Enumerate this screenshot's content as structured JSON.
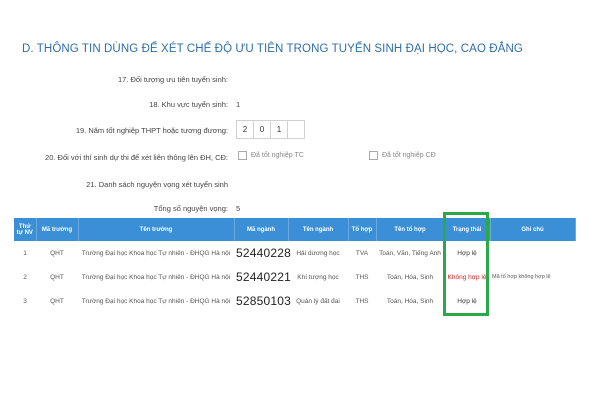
{
  "section": {
    "title": "D. THÔNG TIN DÙNG ĐỂ XÉT CHẾ ĐỘ ƯU TIÊN TRONG TUYỂN SINH ĐẠI HỌC, CAO ĐẲNG"
  },
  "fields": {
    "f17_label": "17. Đối tượng ưu tiên tuyển sinh:",
    "f18_label": "18. Khu vực tuyển sinh:",
    "f18_value": "1",
    "f19_label": "19. Năm tốt nghiệp THPT hoặc tương đương:",
    "f19_digits": [
      "2",
      "0",
      "1",
      ""
    ],
    "f20_label": "20. Đối với thí sinh dự thi để xét liên thông lên ĐH, CĐ:",
    "f20_opt1": "Đã tốt nghiệp TC",
    "f20_opt2": "Đã tốt nghiệp CĐ",
    "f21_label": "21. Danh sách nguyện vọng xét tuyển sinh",
    "total_label": "Tổng số nguyện vọng:",
    "total_value": "5"
  },
  "table": {
    "headers": {
      "nv": "Thứ tự NV",
      "ma_truong": "Mã trường",
      "ten_truong": "Tên trường",
      "ma_nganh": "Mã ngành",
      "ten_nganh": "Tên ngành",
      "to_hop": "Tổ hợp",
      "ten_to_hop": "Tên tổ hợp",
      "trang_thai": "Trạng thái",
      "ghi_chu": "Ghi chú"
    },
    "rows": [
      {
        "nv": "1",
        "ma_truong": "QHT",
        "ten_truong": "Trường Đại học Khoa học Tự nhiên - ĐHQG Hà nội",
        "ma_nganh": "52440228",
        "ten_nganh": "Hải dương học",
        "to_hop": "TVA",
        "ten_to_hop": "Toán, Văn, Tiếng Anh",
        "trang_thai": "Hợp lệ",
        "ghi_chu": ""
      },
      {
        "nv": "2",
        "ma_truong": "QHT",
        "ten_truong": "Trường Đại học Khoa học Tự nhiên - ĐHQG Hà nội",
        "ma_nganh": "52440221",
        "ten_nganh": "Khí tượng học",
        "to_hop": "THS",
        "ten_to_hop": "Toán, Hóa, Sinh",
        "trang_thai": "Không hợp lệ",
        "ghi_chu": "Mã tổ hợp không hợp lệ"
      },
      {
        "nv": "3",
        "ma_truong": "QHT",
        "ten_truong": "Trường Đại học Khoa học Tự nhiên - ĐHQG Hà nội",
        "ma_nganh": "52850103",
        "ten_nganh": "Quản lý đất đai",
        "to_hop": "THS",
        "ten_to_hop": "Toán, Hóa, Sinh",
        "trang_thai": "Hợp lệ",
        "ghi_chu": ""
      }
    ]
  },
  "colors": {
    "title": "#2f6fa8",
    "header_bg": "#3b8fd6",
    "invalid": "#d02020",
    "highlight": "#2aa84a"
  }
}
